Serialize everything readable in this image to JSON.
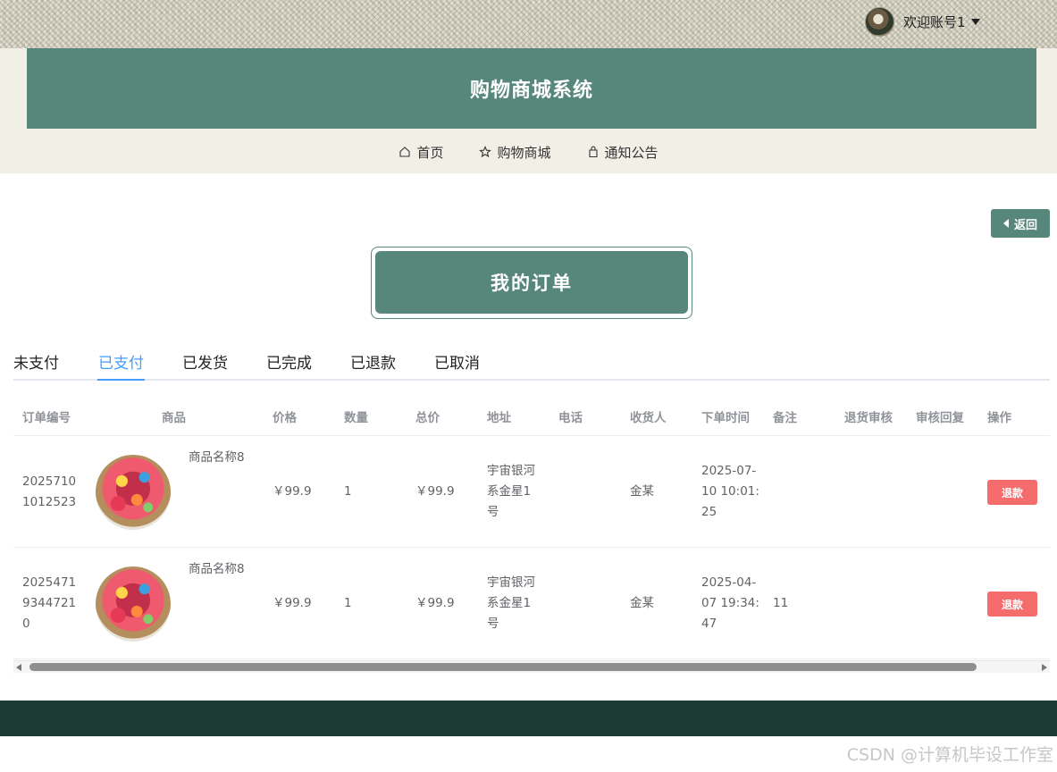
{
  "header": {
    "user_label": "欢迎账号1",
    "site_title": "购物商城系统",
    "nav": [
      {
        "label": "首页",
        "icon": "home-icon"
      },
      {
        "label": "购物商城",
        "icon": "star-icon"
      },
      {
        "label": "通知公告",
        "icon": "bag-icon"
      }
    ]
  },
  "back_label": "返回",
  "page_title": "我的订单",
  "tabs": [
    "未支付",
    "已支付",
    "已发货",
    "已完成",
    "已退款",
    "已取消"
  ],
  "active_tab": "已支付",
  "table": {
    "columns": [
      "订单编号",
      "商品",
      "价格",
      "数量",
      "总价",
      "地址",
      "电话",
      "收货人",
      "下单时间",
      "备注",
      "退货审核",
      "审核回复",
      "操作"
    ],
    "rows": [
      {
        "order_no": [
          "2025710",
          "1012523"
        ],
        "product_name": "商品名称8",
        "price": "￥99.9",
        "qty": "1",
        "total": "￥99.9",
        "address": [
          "宇宙银河",
          "系金星1",
          "号"
        ],
        "phone": "",
        "receiver": "金某",
        "time": [
          "2025-07-",
          "10 10:01:",
          "25"
        ],
        "note": "",
        "return_review": "",
        "review_reply": "",
        "action": "退款"
      },
      {
        "order_no": [
          "2025471",
          "9344721",
          "0"
        ],
        "product_name": "商品名称8",
        "price": "￥99.9",
        "qty": "1",
        "total": "￥99.9",
        "address": [
          "宇宙银河",
          "系金星1",
          "号"
        ],
        "phone": "",
        "receiver": "金某",
        "time": [
          "2025-04-",
          "07 19:34:",
          "47"
        ],
        "note": "11",
        "return_review": "",
        "review_reply": "",
        "action": "退款"
      }
    ]
  },
  "watermark": "CSDN @计算机毕设工作室",
  "colors": {
    "primary": "#57877a",
    "tab_active": "#409eff",
    "danger": "#f56c6c",
    "footer": "#1d3b35"
  }
}
